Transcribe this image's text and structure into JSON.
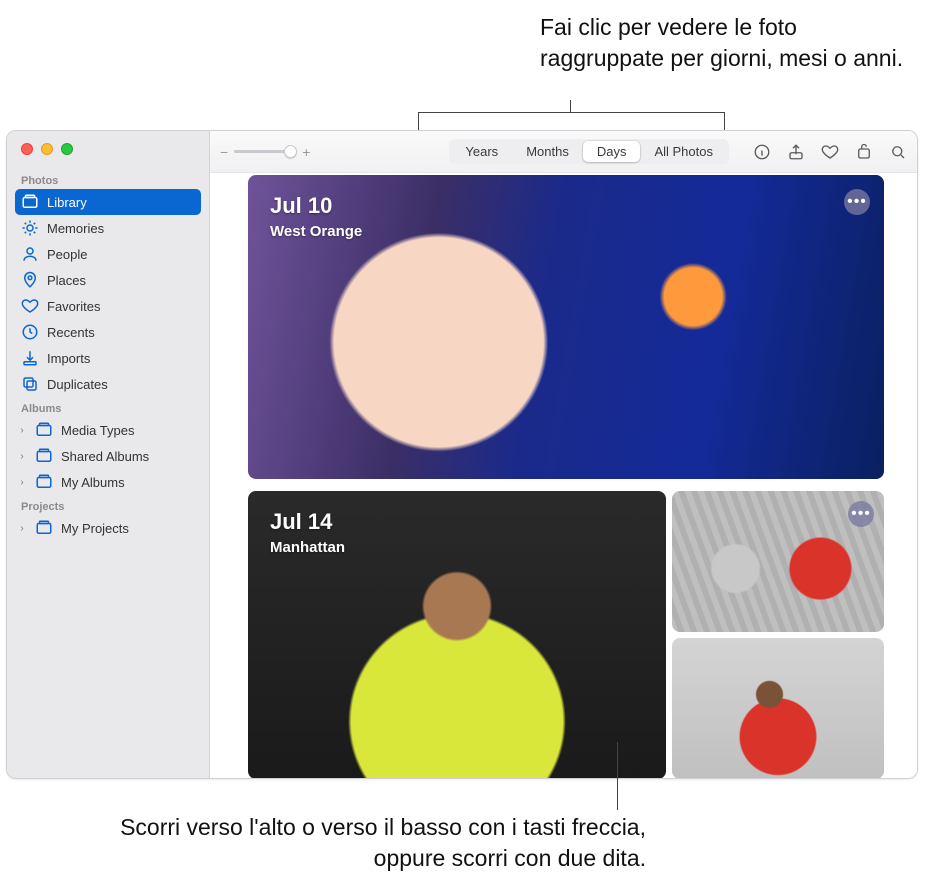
{
  "callouts": {
    "top": "Fai clic per vedere le foto raggruppate per giorni, mesi o anni.",
    "bottom": "Scorri verso l'alto o verso il basso con i tasti freccia, oppure scorri con due dita."
  },
  "sidebar": {
    "sections": {
      "photos": {
        "label": "Photos",
        "items": [
          {
            "label": "Library",
            "icon": "library"
          },
          {
            "label": "Memories",
            "icon": "memories"
          },
          {
            "label": "People",
            "icon": "people"
          },
          {
            "label": "Places",
            "icon": "places"
          },
          {
            "label": "Favorites",
            "icon": "favorites"
          },
          {
            "label": "Recents",
            "icon": "recents"
          },
          {
            "label": "Imports",
            "icon": "imports"
          },
          {
            "label": "Duplicates",
            "icon": "duplicates"
          }
        ]
      },
      "albums": {
        "label": "Albums",
        "items": [
          {
            "label": "Media Types"
          },
          {
            "label": "Shared Albums"
          },
          {
            "label": "My Albums"
          }
        ]
      },
      "projects": {
        "label": "Projects",
        "items": [
          {
            "label": "My Projects"
          }
        ]
      }
    }
  },
  "toolbar": {
    "seg": {
      "years": "Years",
      "months": "Months",
      "days": "Days",
      "all": "All Photos",
      "active": "Days"
    },
    "zoom": {
      "minus": "−",
      "plus": "+"
    }
  },
  "content": {
    "days": [
      {
        "date": "Jul 10",
        "location": "West Orange"
      },
      {
        "date": "Jul 14",
        "location": "Manhattan"
      }
    ]
  }
}
